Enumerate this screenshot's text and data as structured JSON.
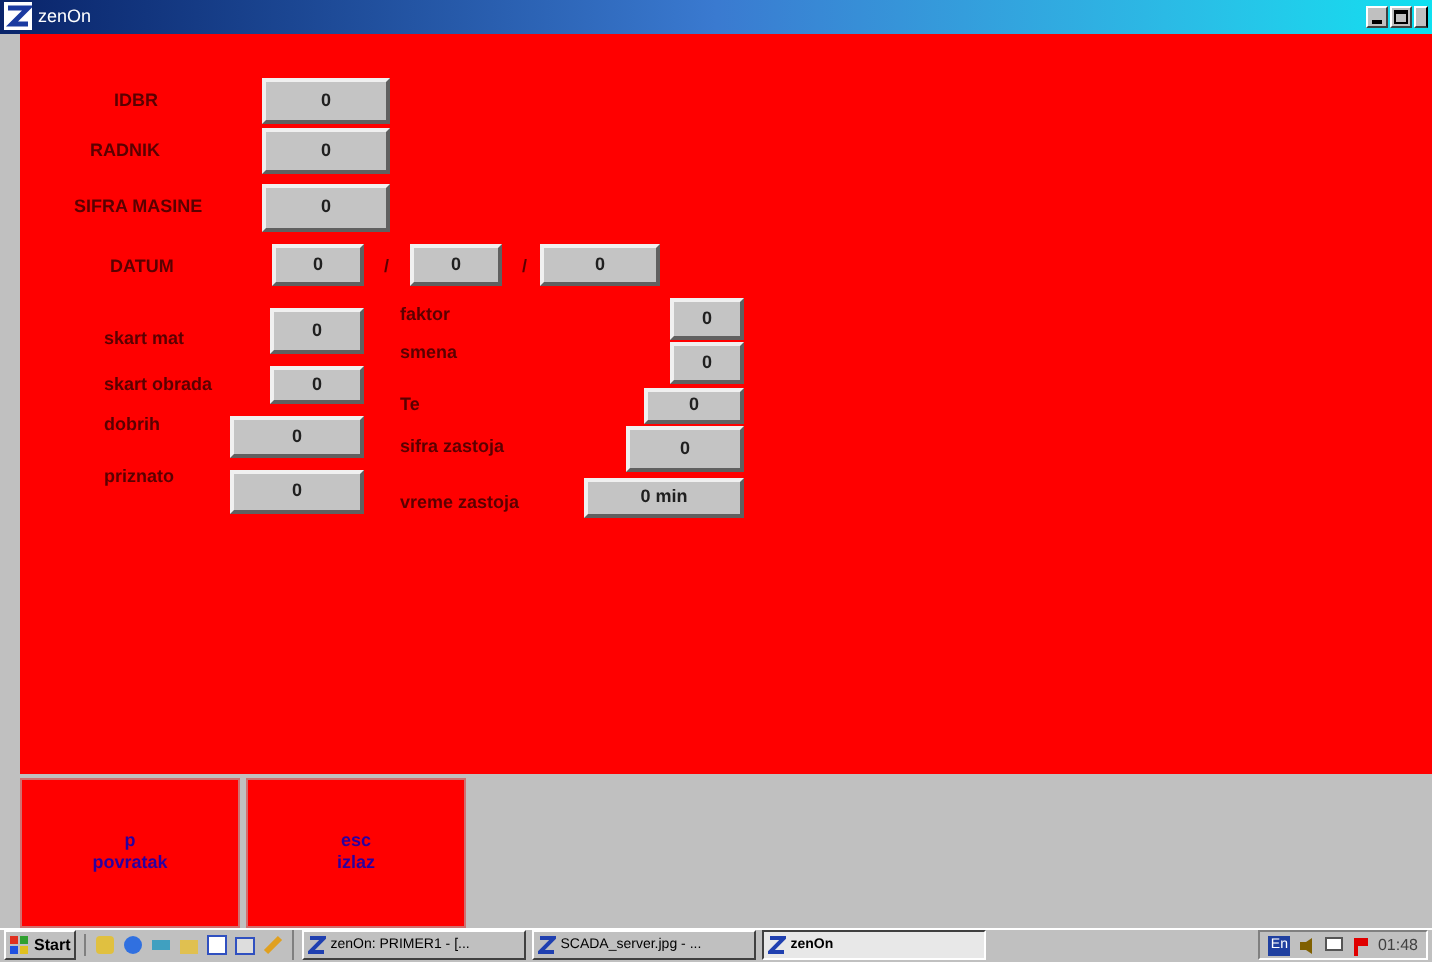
{
  "window": {
    "title": "zenOn"
  },
  "fields": [
    {
      "label": "IDBR",
      "value": "0"
    },
    {
      "label": "RADNIK",
      "value": "0"
    },
    {
      "label": "SIFRA MASINE",
      "value": "0"
    },
    {
      "label": "skart mat",
      "value": "0"
    },
    {
      "label": "skart obrada",
      "value": "0"
    },
    {
      "label": "dobrih",
      "value": "0"
    },
    {
      "label": "priznato",
      "value": "0"
    },
    {
      "label": "faktor",
      "value": "0"
    },
    {
      "label": "smena",
      "value": "0"
    },
    {
      "label": "Te",
      "value": "0"
    },
    {
      "label": "sifra zastoja",
      "value": "0"
    },
    {
      "label": "vreme zastoja",
      "value": "0 min"
    }
  ],
  "date": {
    "label": "DATUM",
    "parts": [
      "0",
      "0",
      "0"
    ],
    "separators": [
      "/",
      "/"
    ]
  },
  "buttons": [
    {
      "key": "p",
      "action": "povratak"
    },
    {
      "key": "esc",
      "action": "izlaz"
    }
  ],
  "taskbar": {
    "start": "Start",
    "tasks": [
      {
        "title": "zenOn: PRIMER1 - [...",
        "selected": false
      },
      {
        "title": "SCADA_server.jpg - ...",
        "selected": false
      },
      {
        "title": "zenOn",
        "selected": true
      }
    ],
    "language": "En",
    "time": "01:48"
  }
}
